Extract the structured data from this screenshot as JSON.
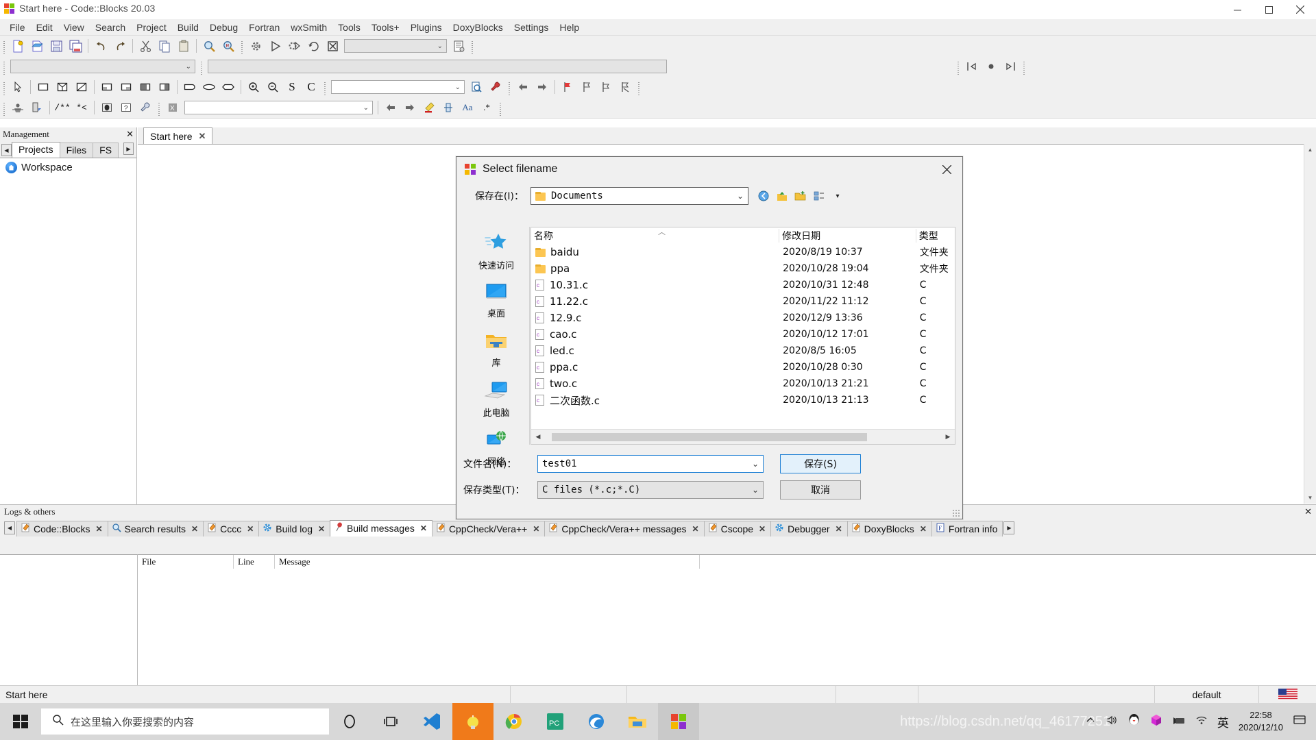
{
  "window": {
    "title": "Start here - Code::Blocks 20.03",
    "minimize": "minimize-icon",
    "maximize": "maximize-icon",
    "close": "close-icon"
  },
  "menubar": {
    "items": [
      "File",
      "Edit",
      "View",
      "Search",
      "Project",
      "Build",
      "Debug",
      "Fortran",
      "wxSmith",
      "Tools",
      "Tools+",
      "Plugins",
      "DoxyBlocks",
      "Settings",
      "Help"
    ]
  },
  "toolbars": {
    "main": [
      "new-file-icon",
      "open-file-icon",
      "save-icon",
      "save-all-icon",
      "undo-icon",
      "redo-icon",
      "cut-icon",
      "copy-icon",
      "paste-icon",
      "find-icon",
      "replace-icon"
    ],
    "compiler": [
      "build-icon",
      "run-icon",
      "build-and-run-icon",
      "rebuild-icon",
      "abort-icon"
    ],
    "target_combo_value": "",
    "debug": [
      "debug-window-icon"
    ],
    "row2_combo_left": "",
    "row2_combo_right": "",
    "wxsmith": [
      "pointer-icon",
      "rect-icon",
      "split-icon",
      "grid-icon",
      "panel-left-icon",
      "panel-top-icon",
      "panel-right-icon",
      "panel-bottom-icon",
      "shape-round-icon",
      "shape-oval-icon",
      "shape-hex-icon",
      "zoom-in-icon",
      "zoom-out-icon",
      "S",
      "C"
    ],
    "wxsmith_combo": "",
    "browse": [
      "browse-find-icon",
      "browse-tools-icon"
    ],
    "nav": [
      "back-icon",
      "forward-icon",
      "bookmark-icon",
      "bookmark-prev-icon",
      "bookmark-next-icon",
      "bookmark-clear-icon"
    ],
    "doxy": [
      "doxy-run-icon",
      "doxy-extract-icon",
      "comment-icon",
      "block-comment-icon",
      "preview-icon",
      "help-icon",
      "config-icon"
    ],
    "fortran_combo": "",
    "fortran_tools": [
      "prev-icon",
      "next-icon",
      "highlight-icon",
      "align-icon",
      "case-icon",
      "regex-icon"
    ]
  },
  "management": {
    "title": "Management",
    "close": "close-icon",
    "scroll_left": "◀",
    "scroll_right": "▶",
    "tabs": [
      {
        "label": "Projects",
        "active": true
      },
      {
        "label": "Files",
        "active": false
      },
      {
        "label": "FS",
        "active": false
      }
    ],
    "tree": {
      "root_label": "Workspace",
      "root_icon": "home-icon"
    }
  },
  "editor": {
    "tabs": [
      {
        "label": "Start here",
        "close": "✕"
      }
    ]
  },
  "logs": {
    "title": "Logs & others",
    "close": "✕",
    "scroll_left": "◀",
    "scroll_right": "▶",
    "tabs": [
      {
        "label": "Code::Blocks",
        "icon": "pencil-icon",
        "active": false
      },
      {
        "label": "Search results",
        "icon": "search-icon",
        "active": false
      },
      {
        "label": "Cccc",
        "icon": "pencil-icon",
        "active": false
      },
      {
        "label": "Build log",
        "icon": "gear-icon",
        "active": false
      },
      {
        "label": "Build messages",
        "icon": "pin-icon",
        "active": true
      },
      {
        "label": "CppCheck/Vera++",
        "icon": "pencil-icon",
        "active": false
      },
      {
        "label": "CppCheck/Vera++ messages",
        "icon": "pencil-icon",
        "active": false
      },
      {
        "label": "Cscope",
        "icon": "pencil-icon",
        "active": false
      },
      {
        "label": "Debugger",
        "icon": "gear-icon",
        "active": false
      },
      {
        "label": "DoxyBlocks",
        "icon": "pencil-icon",
        "active": false
      },
      {
        "label": "Fortran info",
        "icon": "f-icon",
        "active": false
      }
    ],
    "grid_headers": [
      "File",
      "Line",
      "Message"
    ],
    "rows": []
  },
  "statusbar": {
    "left": "Start here",
    "cells": [
      "",
      "",
      "",
      ""
    ],
    "profile": "default",
    "flag": "us-flag-icon"
  },
  "taskbar": {
    "start": "windows-start-icon",
    "search_placeholder": "在这里输入你要搜索的内容",
    "search_icon": "search-icon",
    "buttons": [
      "cortana-icon",
      "task-view-icon",
      "vscode-icon",
      "codeblocks-icon",
      "chrome-icon",
      "pycharm-icon",
      "edge-icon",
      "explorer-icon",
      "codeblocks-dialog-icon"
    ],
    "tray": [
      "chevron-up-icon",
      "volume-icon",
      "qq-icon",
      "cube-icon",
      "nvidia-icon",
      "wifi-icon"
    ],
    "ime": "英",
    "time": "22:58",
    "date": "2020/12/10",
    "action_center": "notification-icon",
    "watermark": "https://blog.csdn.net/qq_46177251"
  },
  "dialog": {
    "title": "Select filename",
    "icon": "codeblocks-icon",
    "close": "✕",
    "save_in_label": "保存在(I)：",
    "current_folder": "Documents",
    "folder_icon": "folder-icon",
    "toolbar_icons": [
      "back-icon",
      "up-folder-icon",
      "new-folder-icon",
      "view-mode-icon",
      "chevron-down-icon"
    ],
    "places": [
      {
        "label": "快速访问",
        "icon": "quick-access-star-icon"
      },
      {
        "label": "桌面",
        "icon": "desktop-icon"
      },
      {
        "label": "库",
        "icon": "library-folder-icon"
      },
      {
        "label": "此电脑",
        "icon": "this-pc-icon"
      },
      {
        "label": "网络",
        "icon": "network-icon"
      }
    ],
    "columns": [
      "名称",
      "修改日期",
      "类型"
    ],
    "files": [
      {
        "name": "baidu",
        "date": "2020/8/19 10:37",
        "type": "文件夹",
        "kind": "folder"
      },
      {
        "name": "ppa",
        "date": "2020/10/28 19:04",
        "type": "文件夹",
        "kind": "folder"
      },
      {
        "name": "10.31.c",
        "date": "2020/10/31 12:48",
        "type": "C",
        "kind": "c-file"
      },
      {
        "name": "11.22.c",
        "date": "2020/11/22 11:12",
        "type": "C",
        "kind": "c-file"
      },
      {
        "name": "12.9.c",
        "date": "2020/12/9 13:36",
        "type": "C",
        "kind": "c-file"
      },
      {
        "name": "cao.c",
        "date": "2020/10/12 17:01",
        "type": "C",
        "kind": "c-file"
      },
      {
        "name": "led.c",
        "date": "2020/8/5 16:05",
        "type": "C",
        "kind": "c-file"
      },
      {
        "name": "ppa.c",
        "date": "2020/10/28 0:30",
        "type": "C",
        "kind": "c-file"
      },
      {
        "name": "two.c",
        "date": "2020/10/13 21:21",
        "type": "C",
        "kind": "c-file"
      },
      {
        "name": "二次函数.c",
        "date": "2020/10/13 21:13",
        "type": "C",
        "kind": "c-file"
      }
    ],
    "filename_label": "文件名(N)：",
    "filename_value": "test01",
    "filetype_label": "保存类型(T)：",
    "filetype_value": "C files (*.c;*.C)",
    "save_button": "保存(S)",
    "cancel_button": "取消"
  },
  "colors": {
    "accent": "#1d7fd4",
    "chrome": "#f0f0f0",
    "taskbar": "#d8d8d8"
  }
}
